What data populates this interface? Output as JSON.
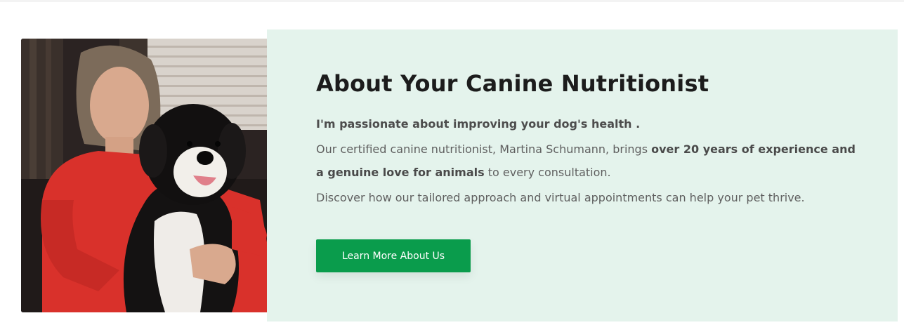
{
  "section": {
    "heading": "About Your Canine Nutritionist",
    "tagline": "I'm passionate about improving your dog's health .",
    "intro_pre": "Our certified canine nutritionist, Martina Schumann, brings ",
    "intro_bold": "over 20 years of experience and a genuine love for animals",
    "intro_post": " to every consultation.",
    "discover": "Discover how our tailored approach and virtual appointments can help your pet thrive.",
    "cta_label": "Learn More About Us",
    "photo_alt": "Woman in a red top holding a black and white dog"
  },
  "colors": {
    "card_background": "#e4f3ec",
    "button_green": "#0a9c4c",
    "heading_text": "#1c1c1c",
    "body_text": "#5f5f5f"
  }
}
